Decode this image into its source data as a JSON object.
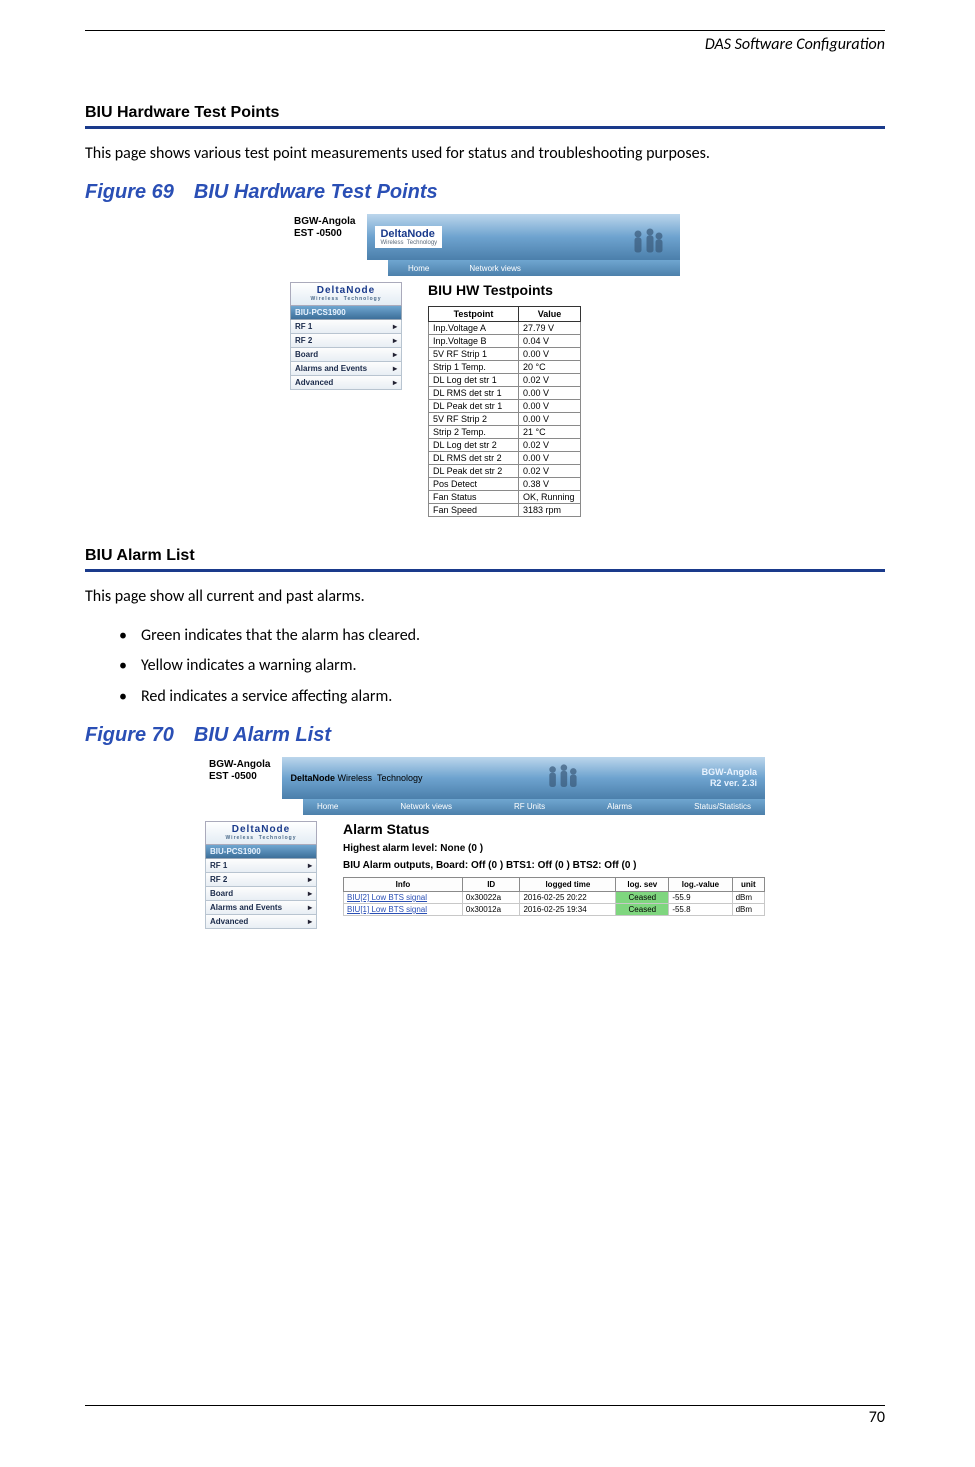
{
  "header": {
    "title": "DAS Software Configuration"
  },
  "page_number": "70",
  "section1": {
    "heading": "BIU Hardware Test Points",
    "text": "This page shows various test point measurements used for status and troubleshooting purposes.",
    "figure_caption": "Figure 69 BIU Hardware Test Points"
  },
  "section2": {
    "heading": "BIU Alarm List",
    "text": "This page show all current and past alarms.",
    "bullets": [
      "Green indicates that the alarm has cleared.",
      "Yellow indicates a warning alarm.",
      "Red indicates a service affecting alarm."
    ],
    "figure_caption": "Figure 70 BIU Alarm List"
  },
  "brand": {
    "name": "DeltaNode",
    "tagline": "Wireless  Technology"
  },
  "fig69": {
    "bgw": {
      "line1": "BGW-Angola",
      "line2": "EST -0500"
    },
    "tabs": {
      "home": "Home",
      "network": "Network views"
    },
    "sidebar": {
      "head": "BIU-PCS1900",
      "items": [
        "RF 1",
        "RF 2",
        "Board",
        "Alarms and Events",
        "Advanced"
      ]
    },
    "tp_title": "BIU HW Testpoints",
    "th": {
      "tp": "Testpoint",
      "val": "Value"
    },
    "rows": [
      {
        "tp": "Inp.Voltage A",
        "val": "27.79 V"
      },
      {
        "tp": "Inp.Voltage B",
        "val": "0.04 V"
      },
      {
        "tp": "5V RF Strip 1",
        "val": "0.00 V"
      },
      {
        "tp": "Strip 1 Temp.",
        "val": "20 °C"
      },
      {
        "tp": "DL Log det str 1",
        "val": "0.02 V"
      },
      {
        "tp": "DL RMS det str 1",
        "val": "0.00 V"
      },
      {
        "tp": "DL Peak det str 1",
        "val": "0.00 V"
      },
      {
        "tp": "5V RF Strip 2",
        "val": "0.00 V"
      },
      {
        "tp": "Strip 2 Temp.",
        "val": "21 °C"
      },
      {
        "tp": "DL Log det str 2",
        "val": "0.02 V"
      },
      {
        "tp": "DL RMS det str 2",
        "val": "0.00 V"
      },
      {
        "tp": "DL Peak det str 2",
        "val": "0.02 V"
      },
      {
        "tp": "Pos Detect",
        "val": "0.38 V"
      },
      {
        "tp": "Fan Status",
        "val": "OK, Running"
      },
      {
        "tp": "Fan Speed",
        "val": "3183 rpm"
      }
    ]
  },
  "fig70": {
    "bgw": {
      "line1": "BGW-Angola",
      "line2": "EST -0500"
    },
    "banner_right": {
      "l1": "BGW-Angola",
      "l2": "R2 ver. 2.3i"
    },
    "tabs": [
      "Home",
      "Network views",
      "RF Units",
      "Alarms",
      "Status/Statistics"
    ],
    "sidebar": {
      "head": "BIU-PCS1900",
      "items": [
        "RF 1",
        "RF 2",
        "Board",
        "Alarms and Events",
        "Advanced"
      ]
    },
    "al_title": "Alarm Status",
    "al_highest": "Highest alarm level: None (0 )",
    "al_outputs": "BIU Alarm outputs, Board: Off (0 ) BTS1: Off (0 ) BTS2: Off (0 )",
    "th": {
      "info": "Info",
      "id": "ID",
      "time": "logged time",
      "sev": "log. sev",
      "val": "log.-value",
      "unit": "unit"
    },
    "rows": [
      {
        "info": "BIU[2] Low BTS signal",
        "id": "0x30022a",
        "time": "2016-02-25 20:22",
        "sev": "Ceased",
        "val": "-55.9",
        "unit": "dBm"
      },
      {
        "info": "BIU[1] Low BTS signal",
        "id": "0x30012a",
        "time": "2016-02-25 19:34",
        "sev": "Ceased",
        "val": "-55.8",
        "unit": "dBm"
      }
    ]
  }
}
